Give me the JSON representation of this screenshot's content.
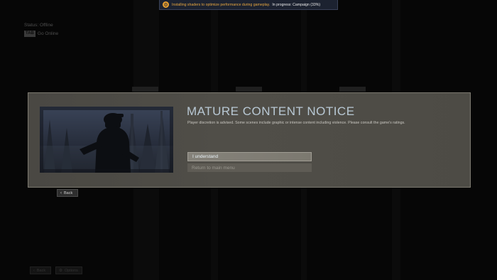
{
  "shader_banner": {
    "message": "Installing shaders to optimize performance during gameplay.",
    "progress": "In progress: Campaign (33%)",
    "progress_percent": 33,
    "icon": "shader-warning-icon"
  },
  "status": {
    "label": "Status: Offline",
    "online_key": "TAB",
    "online_label": "Go Online"
  },
  "modal": {
    "title": "MATURE CONTENT NOTICE",
    "description": "Player discretion is advised. Some scenes include graphic or intense content including violence. Please consult the game's ratings.",
    "primary_button": "I understand",
    "secondary_button": "Return to main menu"
  },
  "back_button": {
    "label": "Back",
    "icon": "chevron-left-icon"
  },
  "bottom_bar": {
    "back_label": "Back",
    "options_label": "Options"
  },
  "colors": {
    "title": "#b8c8d4",
    "banner_accent": "#e6a640",
    "modal_bg": "#4d4b45"
  }
}
